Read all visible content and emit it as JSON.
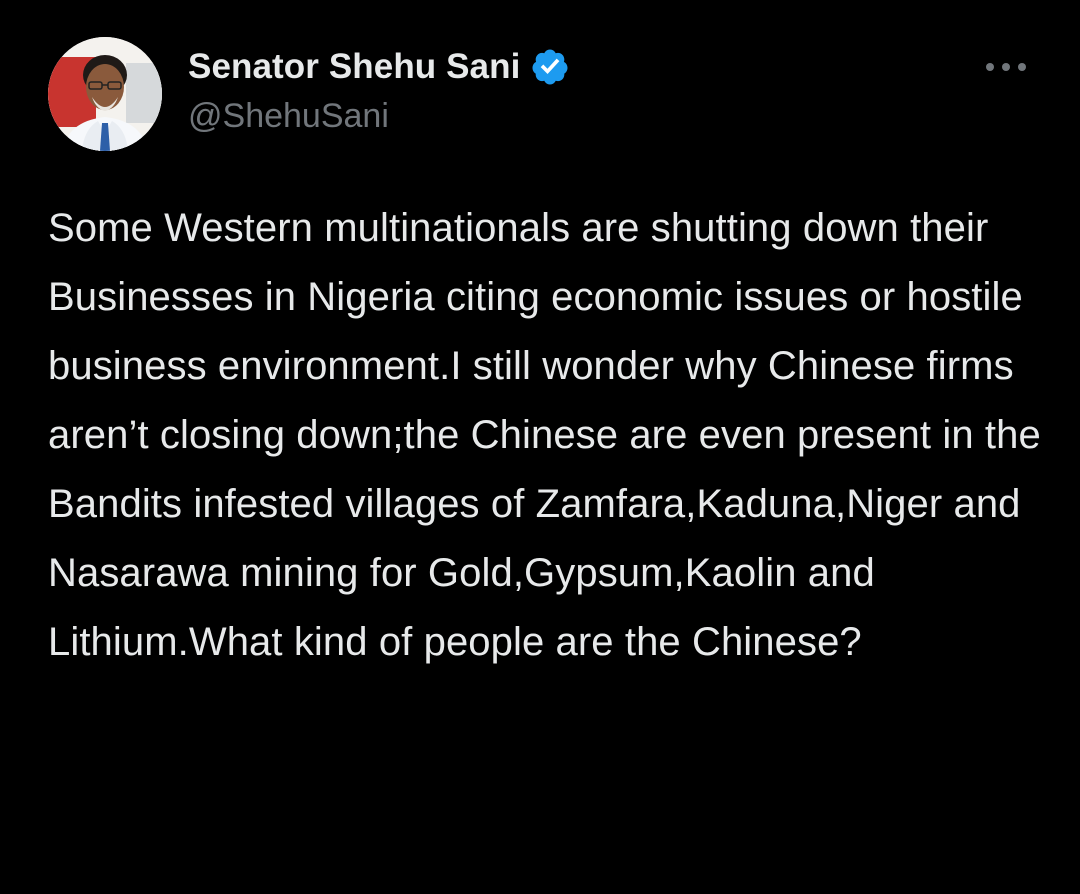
{
  "author": {
    "display_name": "Senator Shehu Sani",
    "handle": "@ShehuSani",
    "verified": true,
    "avatar_icon": "profile-photo",
    "verified_icon": "verified-badge-icon",
    "verified_color": "#1d9bf0"
  },
  "actions": {
    "more_icon": "more-options-icon"
  },
  "tweet": {
    "text": "Some Western multinationals are shutting down their Businesses in Nigeria citing economic issues or hostile business environment.I still wonder why Chinese firms aren’t closing down;the Chinese are even present in the Bandits infested villages of Zamfara,Kaduna,Niger and Nasarawa mining for Gold,Gypsum,Kaolin and Lithium.What kind of people are the Chinese?"
  },
  "theme": {
    "background": "#000000",
    "text_primary": "#e7e9ea",
    "text_secondary": "#71767b"
  }
}
